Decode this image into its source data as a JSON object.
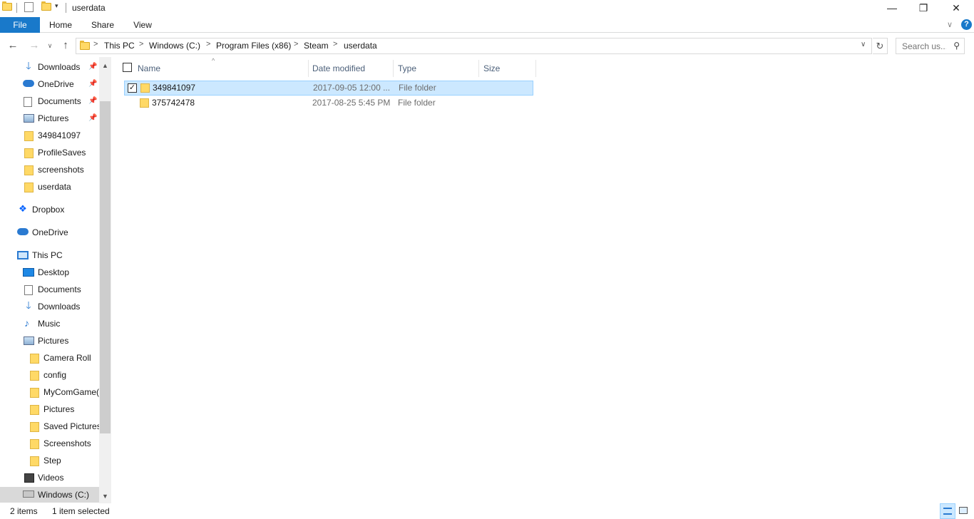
{
  "window": {
    "title": "userdata",
    "minimize_glyph": "—",
    "restore_glyph": "❐",
    "close_glyph": "✕"
  },
  "ribbon": {
    "tabs": [
      "File",
      "Home",
      "Share",
      "View"
    ],
    "expand_glyph": "∨",
    "help_glyph": "?"
  },
  "navigation": {
    "back_glyph": "←",
    "forward_glyph": "→",
    "recent_glyph": "∨",
    "up_glyph": "↑"
  },
  "address": {
    "breadcrumbs": [
      "This PC",
      "Windows (C:)",
      "Program Files (x86)",
      "Steam",
      "userdata"
    ],
    "separator": ">",
    "dropdown_glyph": "∨",
    "refresh_glyph": "↻"
  },
  "search": {
    "placeholder": "Search us...",
    "icon_glyph": "⚲"
  },
  "nav_pane": {
    "items": [
      {
        "label": "Downloads",
        "icon": "download-icon",
        "pinned": true
      },
      {
        "label": "OneDrive",
        "icon": "cloud-icon",
        "pinned": true
      },
      {
        "label": "Documents",
        "icon": "document-icon",
        "pinned": true
      },
      {
        "label": "Pictures",
        "icon": "pictures-icon",
        "pinned": true
      },
      {
        "label": "349841097",
        "icon": "folder-icon",
        "pinned": false
      },
      {
        "label": "ProfileSaves",
        "icon": "folder-icon",
        "pinned": false
      },
      {
        "label": "screenshots",
        "icon": "folder-icon",
        "pinned": false
      },
      {
        "label": "userdata",
        "icon": "folder-icon",
        "pinned": false
      },
      {
        "label": "Dropbox",
        "icon": "dropbox-icon",
        "pinned": false
      },
      {
        "label": "OneDrive",
        "icon": "cloud-icon",
        "pinned": false
      },
      {
        "label": "This PC",
        "icon": "computer-icon",
        "pinned": false
      },
      {
        "label": "Desktop",
        "icon": "desktop-icon",
        "pinned": false
      },
      {
        "label": "Documents",
        "icon": "document-icon",
        "pinned": false
      },
      {
        "label": "Downloads",
        "icon": "download-icon",
        "pinned": false
      },
      {
        "label": "Music",
        "icon": "music-icon",
        "pinned": false
      },
      {
        "label": "Pictures",
        "icon": "pictures-icon",
        "pinned": false
      },
      {
        "label": "Camera Roll",
        "icon": "folder-icon",
        "pinned": false
      },
      {
        "label": "config",
        "icon": "folder-icon",
        "pinned": false
      },
      {
        "label": "MyComGame(",
        "icon": "folder-icon",
        "pinned": false
      },
      {
        "label": "Pictures",
        "icon": "folder-icon",
        "pinned": false
      },
      {
        "label": "Saved Pictures",
        "icon": "folder-icon",
        "pinned": false
      },
      {
        "label": "Screenshots",
        "icon": "folder-icon",
        "pinned": false
      },
      {
        "label": "Step",
        "icon": "folder-icon",
        "pinned": false
      },
      {
        "label": "Videos",
        "icon": "video-icon",
        "pinned": false
      },
      {
        "label": "Windows (C:)",
        "icon": "drive-icon",
        "pinned": false,
        "selected": true
      }
    ],
    "pin_glyph": "📌",
    "scroll_up_glyph": "▲",
    "scroll_down_glyph": "▼"
  },
  "file_list": {
    "columns": [
      "Name",
      "Date modified",
      "Type",
      "Size"
    ],
    "sort_glyph": "^",
    "check_glyph": "✓",
    "rows": [
      {
        "name": "349841097",
        "date": "2017-09-05 12:00 ...",
        "type": "File folder",
        "size": "",
        "selected": true
      },
      {
        "name": "375742478",
        "date": "2017-08-25 5:45 PM",
        "type": "File folder",
        "size": "",
        "selected": false
      }
    ]
  },
  "status": {
    "item_count": "2 items",
    "selection": "1 item selected"
  },
  "colors": {
    "accent": "#1979ca",
    "selection": "#cce8ff",
    "folder": "#ffd966"
  }
}
